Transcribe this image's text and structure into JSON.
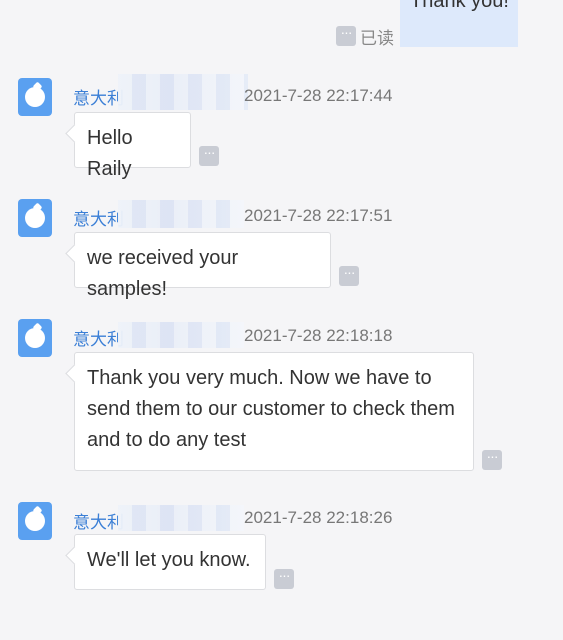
{
  "own_message": {
    "text": "Thank you!",
    "status": "已读",
    "more": "···"
  },
  "messages": [
    {
      "sender": "意大利",
      "time": "2021-7-28 22:17:44",
      "text": "Hello Raily",
      "more": "···"
    },
    {
      "sender": "意大利",
      "time": "2021-7-28 22:17:51",
      "text": "we received your samples!",
      "more": "···"
    },
    {
      "sender": "意大利",
      "time": "2021-7-28 22:18:18",
      "text": "Thank you very much. Now we have to send them to our customer to check them and to do any test",
      "more": "···"
    },
    {
      "sender": "意大利",
      "time": "2021-7-28 22:18:26",
      "text": "We'll let you know.",
      "more": "···"
    }
  ],
  "colors": {
    "accent": "#3b7fd6",
    "own_bubble": "#dde9fb",
    "avatar": "#5aa0f0"
  }
}
